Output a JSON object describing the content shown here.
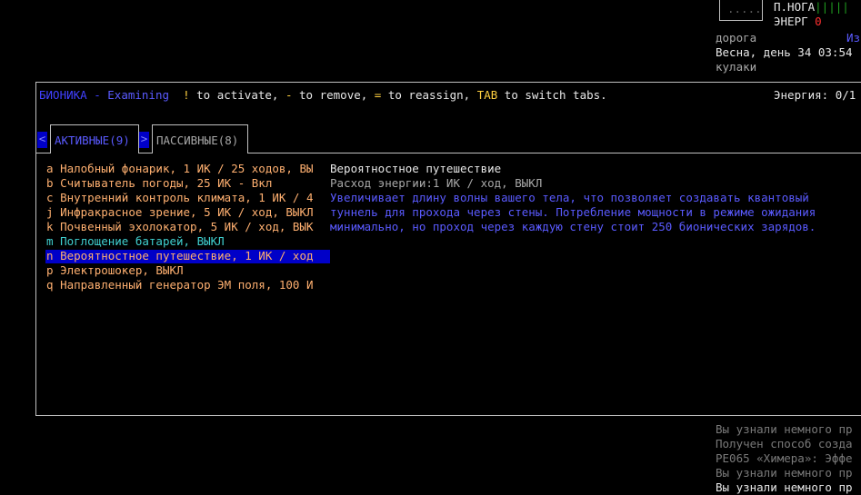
{
  "status": {
    "mini_box": ".....",
    "leg_label": "П.НОГА",
    "leg_bars": "|||||",
    "energy_label": "ЭНЕРГ",
    "energy_value": "0",
    "terrain": "дорога",
    "terrain_extra": "Из",
    "date_time": "Весна, день 34 03:54",
    "weapon": "кулаки"
  },
  "header": {
    "title": "БИОНИКА",
    "separator": " - ",
    "mode": "Examining",
    "hint_key1": "!",
    "hint_text1": " to activate, ",
    "hint_key2": "-",
    "hint_text2": " to remove, ",
    "hint_key3": "=",
    "hint_text3": " to reassign, ",
    "hint_key4": "TAB",
    "hint_text4": " to switch tabs.",
    "energy": "Энергия: 0/1"
  },
  "tabs": {
    "left_arrow": "<",
    "right_arrow": ">",
    "active": "АКТИВНЫЕ(9)",
    "passive": "ПАССИВНЫЕ(8)"
  },
  "items": [
    {
      "key": "a",
      "text": "Налобный фонарик, 1 ИК / 25 ходов, ВЫ"
    },
    {
      "key": "b",
      "text": "Считыватель погоды, 25 ИК - Вкл"
    },
    {
      "key": "c",
      "text": "Внутренний контроль климата, 1 ИК / 4"
    },
    {
      "key": "j",
      "text": "Инфракрасное зрение, 5 ИК / ход, ВЫКЛ"
    },
    {
      "key": "k",
      "text": "Почвенный эхолокатор, 5 ИК / ход, ВЫК"
    },
    {
      "key": "m",
      "text": "Поглощение батарей, ВЫКЛ"
    },
    {
      "key": "n",
      "text": "Вероятностное путешествие, 1 ИК / ход"
    },
    {
      "key": "p",
      "text": "Электрошокер, ВЫКЛ"
    },
    {
      "key": "q",
      "text": "Направленный генератор ЭМ поля, 100 И"
    }
  ],
  "description": {
    "name": "Вероятностное путешествие",
    "cost": "Расход энергии:1 ИК / ход, ВЫКЛ",
    "line1": "Увеличивает длину волны вашего тела, что позволяет создавать квантовый",
    "line2": "туннель для прохода через стены. Потребление мощности в режиме ожидания",
    "line3": "минимально, но проход через каждую стену стоит 250 бионических зарядов."
  },
  "log": [
    "Вы узнали немного пр",
    "Получен способ созда",
    "PE065 «Химера»: Эффе",
    "Вы узнали немного пр",
    "Вы узнали немного пр"
  ],
  "colors": {
    "selection": "#0000c8",
    "accent_blue": "#5a5aff",
    "hint_yellow": "#ffd040",
    "energy_red": "#ff3030"
  }
}
